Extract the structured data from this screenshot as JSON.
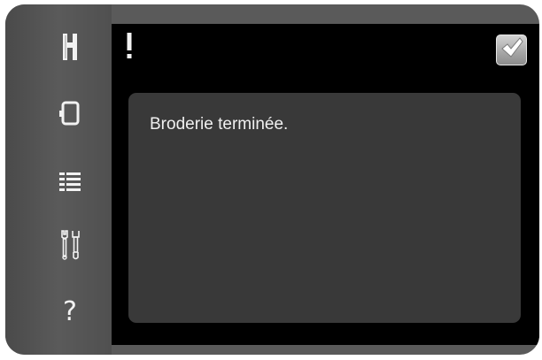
{
  "sidebar": {
    "items": [
      {
        "icon": "sewing-presser-foot-icon"
      },
      {
        "icon": "hoop-icon"
      },
      {
        "icon": "list-icon"
      },
      {
        "icon": "tools-icon"
      },
      {
        "icon": "help-icon",
        "glyph": "?"
      }
    ]
  },
  "dialog": {
    "alert_symbol": "!",
    "message": "Broderie terminée.",
    "confirm_icon": "checkmark-icon"
  },
  "colors": {
    "frame": "#5a5a5a",
    "screen_background": "#000000",
    "message_box": "#393939",
    "text": "#f0f0f0"
  }
}
